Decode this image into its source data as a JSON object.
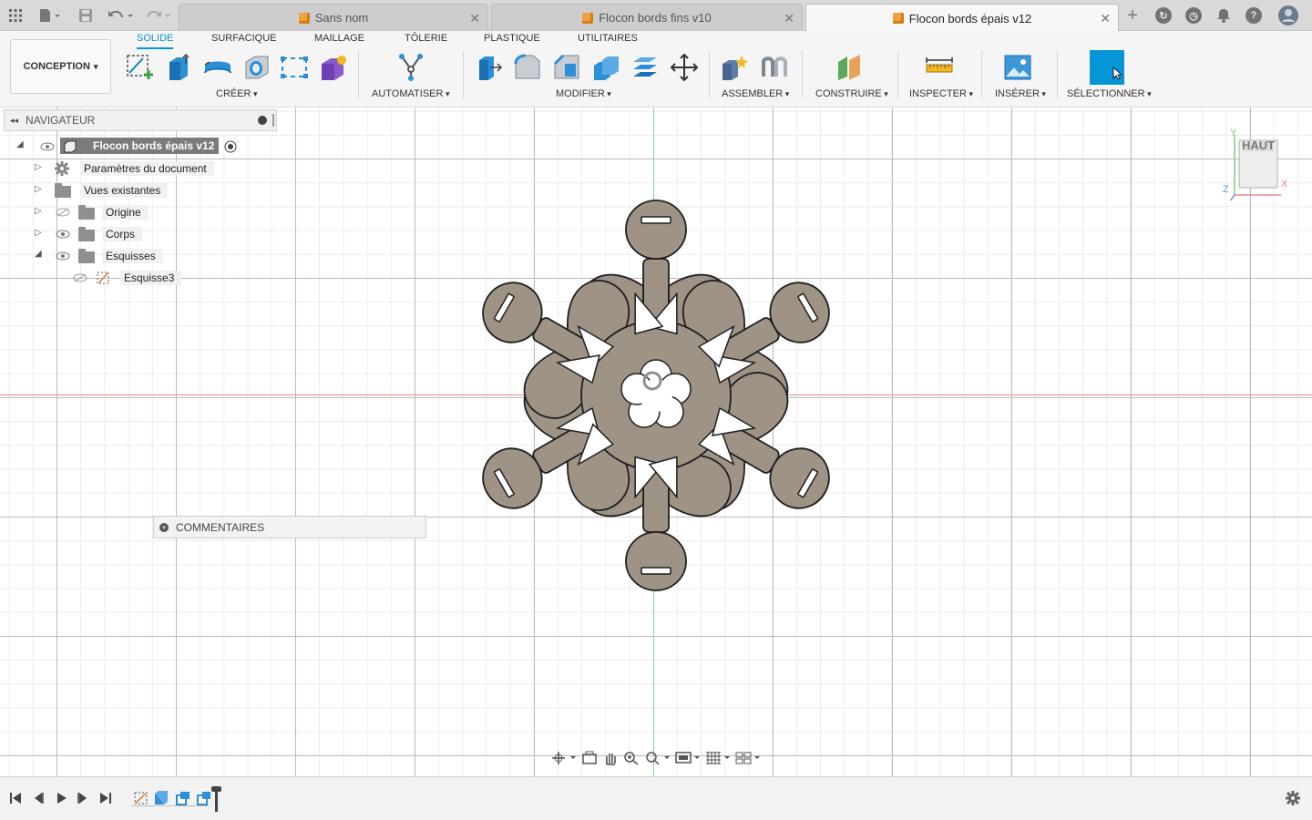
{
  "tabs": [
    {
      "label": "Sans nom"
    },
    {
      "label": "Flocon bords fins v10"
    },
    {
      "label": "Flocon bords épais v12",
      "active": true
    }
  ],
  "workspace": {
    "label": "CONCEPTION"
  },
  "ribbon_tabs": [
    "SOLIDE",
    "SURFACIQUE",
    "MAILLAGE",
    "TÔLERIE",
    "PLASTIQUE",
    "UTILITAIRES"
  ],
  "groups": {
    "create": "CRÉER",
    "automate": "AUTOMATISER",
    "modify": "MODIFIER",
    "assemble": "ASSEMBLER",
    "construct": "CONSTRUIRE",
    "inspect": "INSPECTER",
    "insert": "INSÉRER",
    "select": "SÉLECTIONNER"
  },
  "navigator": {
    "title": "NAVIGATEUR",
    "root": "Flocon bords épais v12",
    "items": [
      {
        "label": "Paramètres du document"
      },
      {
        "label": "Vues existantes"
      },
      {
        "label": "Origine"
      },
      {
        "label": "Corps"
      },
      {
        "label": "Esquisses"
      },
      {
        "label": "Esquisse3"
      }
    ]
  },
  "comments": {
    "label": "COMMENTAIRES"
  },
  "viewcube": {
    "face": "HAUT",
    "axis_x": "X",
    "axis_y": "Y",
    "axis_z": "Z"
  },
  "colors": {
    "accent": "#0696d7",
    "body": "#9e9385",
    "x_axis": "#e58a8a",
    "y_axis": "#8fd38f"
  }
}
